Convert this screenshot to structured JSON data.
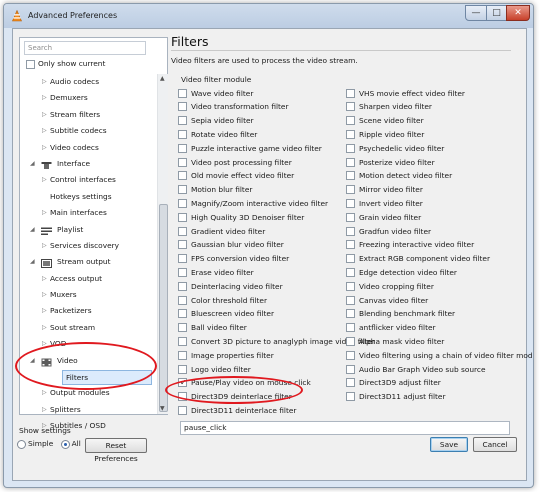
{
  "window": {
    "title": "Advanced Preferences",
    "minimize": "—",
    "maximize": "□",
    "close": "✕"
  },
  "sidebar": {
    "search_placeholder": "Search",
    "only_show_current": "Only show current",
    "items": [
      {
        "label": "Audio codecs",
        "level": 2,
        "arrow": "▷"
      },
      {
        "label": "Demuxers",
        "level": 2,
        "arrow": "▷"
      },
      {
        "label": "Stream filters",
        "level": 2,
        "arrow": "▷"
      },
      {
        "label": "Subtitle codecs",
        "level": 2,
        "arrow": "▷"
      },
      {
        "label": "Video codecs",
        "level": 2,
        "arrow": "▷"
      },
      {
        "label": "Interface",
        "level": 1,
        "arrow": "◢",
        "icon": "interface-icon"
      },
      {
        "label": "Control interfaces",
        "level": 2,
        "arrow": "▷"
      },
      {
        "label": "Hotkeys settings",
        "level": 2,
        "arrow": ""
      },
      {
        "label": "Main interfaces",
        "level": 2,
        "arrow": "▷"
      },
      {
        "label": "Playlist",
        "level": 1,
        "arrow": "◢",
        "icon": "playlist-icon"
      },
      {
        "label": "Services discovery",
        "level": 2,
        "arrow": "▷"
      },
      {
        "label": "Stream output",
        "level": 1,
        "arrow": "◢",
        "icon": "stream-output-icon"
      },
      {
        "label": "Access output",
        "level": 2,
        "arrow": "▷"
      },
      {
        "label": "Muxers",
        "level": 2,
        "arrow": "▷"
      },
      {
        "label": "Packetizers",
        "level": 2,
        "arrow": "▷"
      },
      {
        "label": "Sout stream",
        "level": 2,
        "arrow": "▷"
      },
      {
        "label": "VOD",
        "level": 2,
        "arrow": "▷"
      },
      {
        "label": "Video",
        "level": 1,
        "arrow": "◢",
        "icon": "video-icon"
      },
      {
        "label": "Filters",
        "level": 2,
        "arrow": "",
        "selected": true
      },
      {
        "label": "Output modules",
        "level": 2,
        "arrow": "▷"
      },
      {
        "label": "Splitters",
        "level": 2,
        "arrow": "▷"
      },
      {
        "label": "Subtitles / OSD",
        "level": 2,
        "arrow": "▷"
      }
    ]
  },
  "bottom": {
    "show_settings": "Show settings",
    "simple": "Simple",
    "all": "All",
    "reset": "Reset Preferences",
    "save": "Save",
    "cancel": "Cancel"
  },
  "panel": {
    "title": "Filters",
    "description": "Video filters are used to process the video stream.",
    "group_label": "Video filter module",
    "left_filters": [
      {
        "label": "Wave video filter",
        "checked": false
      },
      {
        "label": "Video transformation filter",
        "checked": false
      },
      {
        "label": "Sepia video filter",
        "checked": false
      },
      {
        "label": "Rotate video filter",
        "checked": false
      },
      {
        "label": "Puzzle interactive game video filter",
        "checked": false
      },
      {
        "label": "Video post processing filter",
        "checked": false
      },
      {
        "label": "Old movie effect video filter",
        "checked": false
      },
      {
        "label": "Motion blur filter",
        "checked": false
      },
      {
        "label": "Magnify/Zoom interactive video filter",
        "checked": false
      },
      {
        "label": "High Quality 3D Denoiser filter",
        "checked": false
      },
      {
        "label": "Gradient video filter",
        "checked": false
      },
      {
        "label": "Gaussian blur video filter",
        "checked": false
      },
      {
        "label": "FPS conversion video filter",
        "checked": false
      },
      {
        "label": "Erase video filter",
        "checked": false
      },
      {
        "label": "Deinterlacing video filter",
        "checked": false
      },
      {
        "label": "Color threshold filter",
        "checked": false
      },
      {
        "label": "Bluescreen video filter",
        "checked": false
      },
      {
        "label": "Ball video filter",
        "checked": false
      },
      {
        "label": "Convert 3D picture to anaglyph image video filter",
        "checked": false
      },
      {
        "label": "Image properties filter",
        "checked": false
      },
      {
        "label": "Logo video filter",
        "checked": false
      },
      {
        "label": "Pause/Play video on mouse click",
        "checked": true
      },
      {
        "label": "Direct3D9 deinterlace filter",
        "checked": false
      },
      {
        "label": "Direct3D11 deinterlace filter",
        "checked": false
      }
    ],
    "right_filters": [
      {
        "label": "VHS movie effect video filter",
        "checked": false
      },
      {
        "label": "Sharpen video filter",
        "checked": false
      },
      {
        "label": "Scene video filter",
        "checked": false
      },
      {
        "label": "Ripple video filter",
        "checked": false
      },
      {
        "label": "Psychedelic video filter",
        "checked": false
      },
      {
        "label": "Posterize video filter",
        "checked": false
      },
      {
        "label": "Motion detect video filter",
        "checked": false
      },
      {
        "label": "Mirror video filter",
        "checked": false
      },
      {
        "label": "Invert video filter",
        "checked": false
      },
      {
        "label": "Grain video filter",
        "checked": false
      },
      {
        "label": "Gradfun video filter",
        "checked": false
      },
      {
        "label": "Freezing interactive video filter",
        "checked": false
      },
      {
        "label": "Extract RGB component video filter",
        "checked": false
      },
      {
        "label": "Edge detection video filter",
        "checked": false
      },
      {
        "label": "Video cropping filter",
        "checked": false
      },
      {
        "label": "Canvas video filter",
        "checked": false
      },
      {
        "label": "Blending benchmark filter",
        "checked": false
      },
      {
        "label": "antflicker video filter",
        "checked": false
      },
      {
        "label": "Alpha mask video filter",
        "checked": false
      },
      {
        "label": "Video filtering using a chain of video filter modules",
        "checked": false
      },
      {
        "label": "Audio Bar Graph Video sub source",
        "checked": false
      },
      {
        "label": "Direct3D9 adjust filter",
        "checked": false
      },
      {
        "label": "Direct3D11 adjust filter",
        "checked": false
      }
    ],
    "filter_value": "pause_click"
  },
  "colors": {
    "annotation": "#e0191f",
    "selection": "#dcebfc",
    "titlebar": "#bccde3"
  }
}
